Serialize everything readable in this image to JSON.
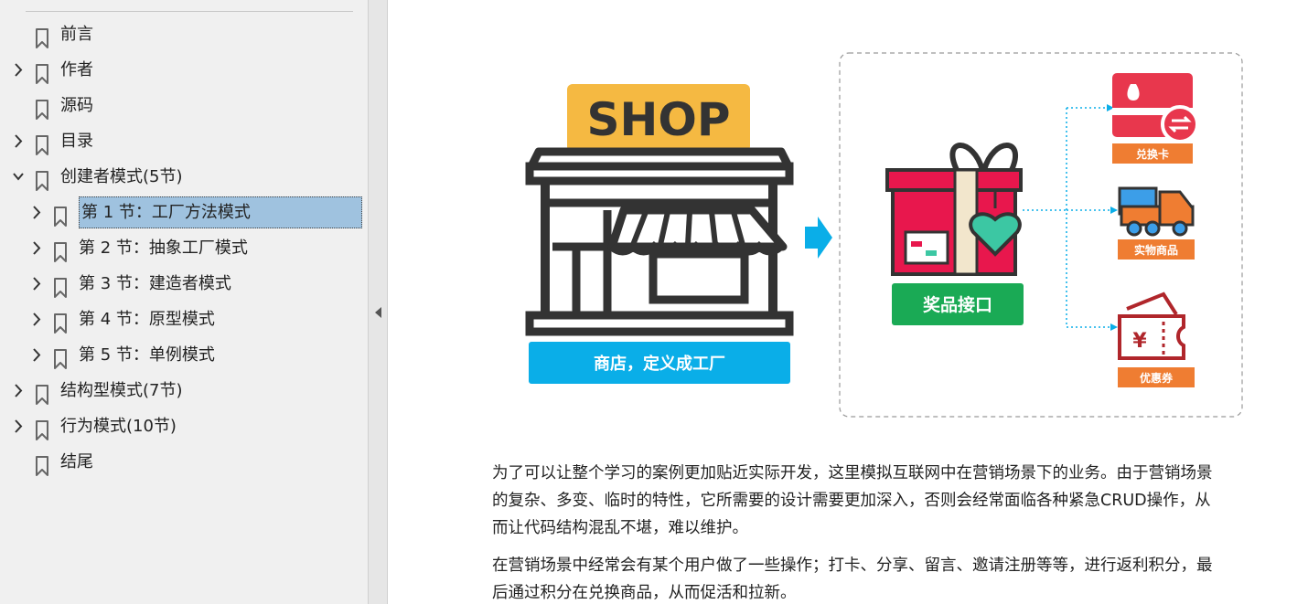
{
  "sidebar": {
    "bookmarks": [
      {
        "label": "前言",
        "level": 0,
        "expandable": false
      },
      {
        "label": "作者",
        "level": 0,
        "expandable": true
      },
      {
        "label": "源码",
        "level": 0,
        "expandable": false
      },
      {
        "label": "目录",
        "level": 0,
        "expandable": true
      },
      {
        "label": "创建者模式(5节)",
        "level": 0,
        "expandable": true,
        "expanded": true
      },
      {
        "label": "第 1 节：工厂方法模式",
        "level": 1,
        "expandable": true,
        "selected": true
      },
      {
        "label": "第 2 节：抽象工厂模式",
        "level": 1,
        "expandable": true
      },
      {
        "label": "第 3 节：建造者模式",
        "level": 1,
        "expandable": true
      },
      {
        "label": "第 4 节：原型模式",
        "level": 1,
        "expandable": true
      },
      {
        "label": "第 5 节：单例模式",
        "level": 1,
        "expandable": true
      },
      {
        "label": "结构型模式(7节)",
        "level": 0,
        "expandable": true
      },
      {
        "label": "行为模式(10节)",
        "level": 0,
        "expandable": true
      },
      {
        "label": "结尾",
        "level": 0,
        "expandable": false
      }
    ]
  },
  "figure": {
    "shop_sign": "SHOP",
    "shop_caption": "商店，定义成工厂",
    "gift_caption": "奖品接口",
    "prizes": [
      "兑换卡",
      "实物商品",
      "优惠券"
    ],
    "colors": {
      "sign": "#f5b942",
      "blue": "#0aaee8",
      "green": "#1aaa55",
      "orange": "#ef7d32",
      "red": "#e8374d",
      "dark": "#333333",
      "teal": "#3cc7a3"
    }
  },
  "content": {
    "para1_lines": [
      "为了可以让整个学习的案例更加贴近实际开发，这里模拟互联网中在营销场景下的业务。由于营销场景",
      "的复杂、多变、临时的特性，它所需要的设计需要更加深入，否则会经常面临各种紧急CRUD操作，从",
      "而让代码结构混乱不堪，难以维护。"
    ],
    "para2_lines": [
      "在营销场景中经常会有某个用户做了一些操作；打卡、分享、留言、邀请注册等等，进行返利积分，最",
      "后通过积分在兑换商品，从而促活和拉新。"
    ]
  }
}
